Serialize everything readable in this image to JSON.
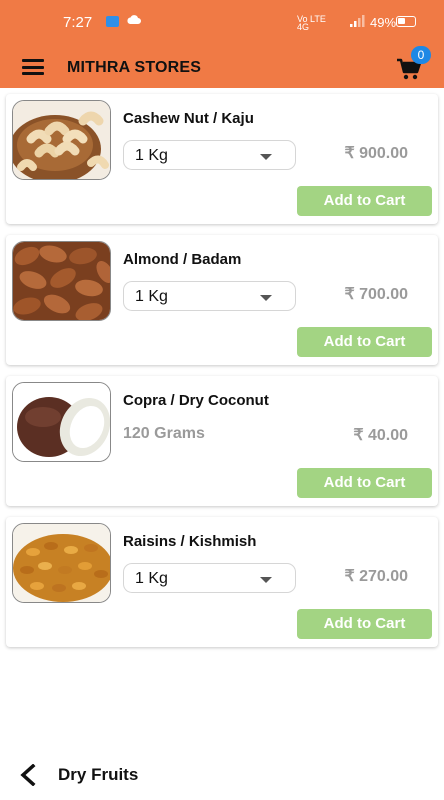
{
  "status_bar": {
    "time": "7:27",
    "network": "Vo LTE",
    "signal": "4G",
    "battery": "49%"
  },
  "app_bar": {
    "title": "MITHRA STORES",
    "cart_count": "0"
  },
  "products": [
    {
      "name": "Cashew Nut / Kaju",
      "quantity": "1 Kg",
      "has_selector": true,
      "price": "₹ 900.00",
      "button": "Add to Cart",
      "image": "cashew-image"
    },
    {
      "name": "Almond / Badam",
      "quantity": "1 Kg",
      "has_selector": true,
      "price": "₹ 700.00",
      "button": "Add to Cart",
      "image": "almond-image"
    },
    {
      "name": "Copra / Dry Coconut",
      "quantity": "120 Grams",
      "has_selector": false,
      "price": "₹ 40.00",
      "button": "Add to Cart",
      "image": "coconut-image"
    },
    {
      "name": "Raisins / Kishmish",
      "quantity": "1 Kg",
      "has_selector": true,
      "price": "₹ 270.00",
      "button": "Add to Cart",
      "image": "raisins-image"
    }
  ],
  "footer": {
    "category": "Dry Fruits"
  },
  "colors": {
    "app_bar": "#f07a45",
    "add_button": "#a3d483",
    "badge": "#1e88e5",
    "price_text": "#9a9a9a"
  }
}
